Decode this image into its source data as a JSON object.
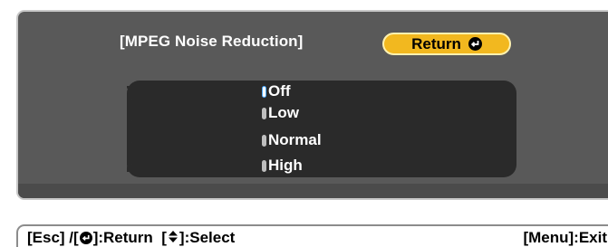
{
  "dialog": {
    "title": "[MPEG Noise Reduction]",
    "return_label": "Return",
    "options": [
      {
        "label": "Off",
        "selected": true
      },
      {
        "label": "Low",
        "selected": false
      },
      {
        "label": "Normal",
        "selected": false
      },
      {
        "label": "High",
        "selected": false
      }
    ]
  },
  "status_bar": {
    "esc_text": "[Esc] /[",
    "return_text": "]:Return  [",
    "select_text": "]:Select",
    "menu_text": "[Menu]:Exit"
  },
  "icons": {
    "enter": "enter-icon",
    "updown": "up-down-arrow-icon"
  },
  "colors": {
    "panel": "#595959",
    "options_bg": "#2a2a2a",
    "return_button": "#f2b81f",
    "selected_radio_border": "#4aa8ff"
  }
}
